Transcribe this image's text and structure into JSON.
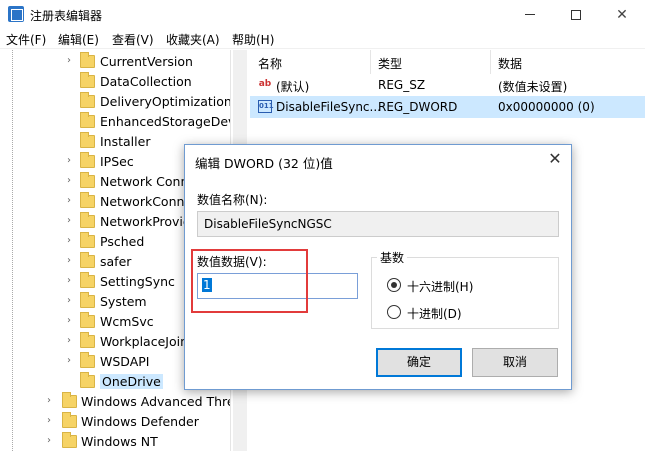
{
  "window": {
    "title": "注册表编辑器",
    "icon": "registry-editor-icon"
  },
  "menu": [
    "文件(F)",
    "编辑(E)",
    "查看(V)",
    "收藏夹(A)",
    "帮助(H)"
  ],
  "tree": {
    "items": [
      {
        "label": "CurrentVersion",
        "expandable": true
      },
      {
        "label": "DataCollection",
        "expandable": false
      },
      {
        "label": "DeliveryOptimization",
        "expandable": false
      },
      {
        "label": "EnhancedStorageDevi",
        "expandable": false
      },
      {
        "label": "Installer",
        "expandable": false
      },
      {
        "label": "IPSec",
        "expandable": true
      },
      {
        "label": "Network Conn",
        "expandable": true
      },
      {
        "label": "NetworkConne",
        "expandable": true
      },
      {
        "label": "NetworkProvid",
        "expandable": true
      },
      {
        "label": "Psched",
        "expandable": true
      },
      {
        "label": "safer",
        "expandable": true
      },
      {
        "label": "SettingSync",
        "expandable": true
      },
      {
        "label": "System",
        "expandable": true
      },
      {
        "label": "WcmSvc",
        "expandable": true
      },
      {
        "label": "WorkplaceJoin",
        "expandable": true
      },
      {
        "label": "WSDAPI",
        "expandable": true
      },
      {
        "label": "OneDrive",
        "expandable": false,
        "selected": true
      },
      {
        "label": "Windows Advanced Threa",
        "expandable": true
      },
      {
        "label": "Windows Defender",
        "expandable": true
      },
      {
        "label": "Windows NT",
        "expandable": true
      }
    ]
  },
  "list": {
    "headers": [
      "名称",
      "类型",
      "数据"
    ],
    "rows": [
      {
        "icon": "string-value-icon",
        "name": "(默认)",
        "type": "REG_SZ",
        "data": "(数值未设置)"
      },
      {
        "icon": "dword-value-icon",
        "name": "DisableFileSync...",
        "type": "REG_DWORD",
        "data": "0x00000000 (0)",
        "selected": true
      }
    ]
  },
  "dialog": {
    "title": "编辑 DWORD (32 位)值",
    "name_label": "数值名称(N):",
    "name_value": "DisableFileSyncNGSC",
    "data_label": "数值数据(V):",
    "data_value": "1",
    "base_label": "基数",
    "base_options": [
      {
        "label": "十六进制(H)",
        "checked": true
      },
      {
        "label": "十进制(D)",
        "checked": false
      }
    ],
    "ok_label": "确定",
    "cancel_label": "取消"
  },
  "colors": {
    "selection": "#cce8ff",
    "highlight_annotation": "#e23b3b",
    "accent": "#0078d7"
  }
}
